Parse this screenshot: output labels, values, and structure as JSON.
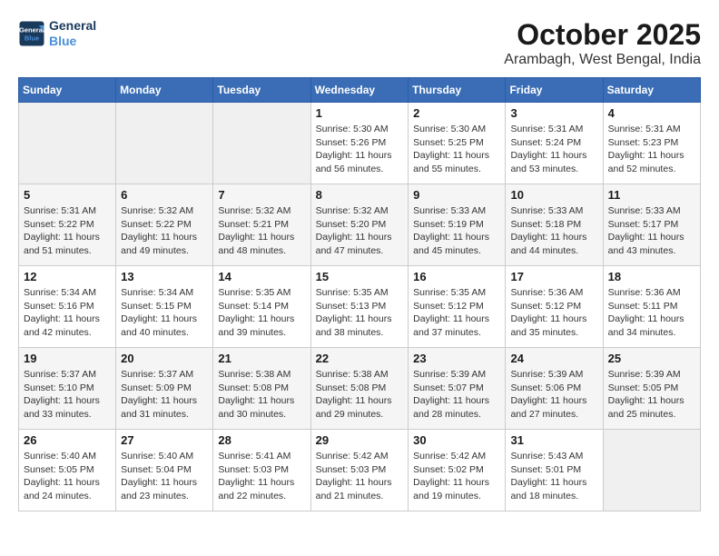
{
  "logo": {
    "line1": "General",
    "line2": "Blue"
  },
  "title": "October 2025",
  "location": "Arambagh, West Bengal, India",
  "days_of_week": [
    "Sunday",
    "Monday",
    "Tuesday",
    "Wednesday",
    "Thursday",
    "Friday",
    "Saturday"
  ],
  "weeks": [
    [
      {
        "day": "",
        "info": ""
      },
      {
        "day": "",
        "info": ""
      },
      {
        "day": "",
        "info": ""
      },
      {
        "day": "1",
        "info": "Sunrise: 5:30 AM\nSunset: 5:26 PM\nDaylight: 11 hours and 56 minutes."
      },
      {
        "day": "2",
        "info": "Sunrise: 5:30 AM\nSunset: 5:25 PM\nDaylight: 11 hours and 55 minutes."
      },
      {
        "day": "3",
        "info": "Sunrise: 5:31 AM\nSunset: 5:24 PM\nDaylight: 11 hours and 53 minutes."
      },
      {
        "day": "4",
        "info": "Sunrise: 5:31 AM\nSunset: 5:23 PM\nDaylight: 11 hours and 52 minutes."
      }
    ],
    [
      {
        "day": "5",
        "info": "Sunrise: 5:31 AM\nSunset: 5:22 PM\nDaylight: 11 hours and 51 minutes."
      },
      {
        "day": "6",
        "info": "Sunrise: 5:32 AM\nSunset: 5:22 PM\nDaylight: 11 hours and 49 minutes."
      },
      {
        "day": "7",
        "info": "Sunrise: 5:32 AM\nSunset: 5:21 PM\nDaylight: 11 hours and 48 minutes."
      },
      {
        "day": "8",
        "info": "Sunrise: 5:32 AM\nSunset: 5:20 PM\nDaylight: 11 hours and 47 minutes."
      },
      {
        "day": "9",
        "info": "Sunrise: 5:33 AM\nSunset: 5:19 PM\nDaylight: 11 hours and 45 minutes."
      },
      {
        "day": "10",
        "info": "Sunrise: 5:33 AM\nSunset: 5:18 PM\nDaylight: 11 hours and 44 minutes."
      },
      {
        "day": "11",
        "info": "Sunrise: 5:33 AM\nSunset: 5:17 PM\nDaylight: 11 hours and 43 minutes."
      }
    ],
    [
      {
        "day": "12",
        "info": "Sunrise: 5:34 AM\nSunset: 5:16 PM\nDaylight: 11 hours and 42 minutes."
      },
      {
        "day": "13",
        "info": "Sunrise: 5:34 AM\nSunset: 5:15 PM\nDaylight: 11 hours and 40 minutes."
      },
      {
        "day": "14",
        "info": "Sunrise: 5:35 AM\nSunset: 5:14 PM\nDaylight: 11 hours and 39 minutes."
      },
      {
        "day": "15",
        "info": "Sunrise: 5:35 AM\nSunset: 5:13 PM\nDaylight: 11 hours and 38 minutes."
      },
      {
        "day": "16",
        "info": "Sunrise: 5:35 AM\nSunset: 5:12 PM\nDaylight: 11 hours and 37 minutes."
      },
      {
        "day": "17",
        "info": "Sunrise: 5:36 AM\nSunset: 5:12 PM\nDaylight: 11 hours and 35 minutes."
      },
      {
        "day": "18",
        "info": "Sunrise: 5:36 AM\nSunset: 5:11 PM\nDaylight: 11 hours and 34 minutes."
      }
    ],
    [
      {
        "day": "19",
        "info": "Sunrise: 5:37 AM\nSunset: 5:10 PM\nDaylight: 11 hours and 33 minutes."
      },
      {
        "day": "20",
        "info": "Sunrise: 5:37 AM\nSunset: 5:09 PM\nDaylight: 11 hours and 31 minutes."
      },
      {
        "day": "21",
        "info": "Sunrise: 5:38 AM\nSunset: 5:08 PM\nDaylight: 11 hours and 30 minutes."
      },
      {
        "day": "22",
        "info": "Sunrise: 5:38 AM\nSunset: 5:08 PM\nDaylight: 11 hours and 29 minutes."
      },
      {
        "day": "23",
        "info": "Sunrise: 5:39 AM\nSunset: 5:07 PM\nDaylight: 11 hours and 28 minutes."
      },
      {
        "day": "24",
        "info": "Sunrise: 5:39 AM\nSunset: 5:06 PM\nDaylight: 11 hours and 27 minutes."
      },
      {
        "day": "25",
        "info": "Sunrise: 5:39 AM\nSunset: 5:05 PM\nDaylight: 11 hours and 25 minutes."
      }
    ],
    [
      {
        "day": "26",
        "info": "Sunrise: 5:40 AM\nSunset: 5:05 PM\nDaylight: 11 hours and 24 minutes."
      },
      {
        "day": "27",
        "info": "Sunrise: 5:40 AM\nSunset: 5:04 PM\nDaylight: 11 hours and 23 minutes."
      },
      {
        "day": "28",
        "info": "Sunrise: 5:41 AM\nSunset: 5:03 PM\nDaylight: 11 hours and 22 minutes."
      },
      {
        "day": "29",
        "info": "Sunrise: 5:42 AM\nSunset: 5:03 PM\nDaylight: 11 hours and 21 minutes."
      },
      {
        "day": "30",
        "info": "Sunrise: 5:42 AM\nSunset: 5:02 PM\nDaylight: 11 hours and 19 minutes."
      },
      {
        "day": "31",
        "info": "Sunrise: 5:43 AM\nSunset: 5:01 PM\nDaylight: 11 hours and 18 minutes."
      },
      {
        "day": "",
        "info": ""
      }
    ]
  ]
}
